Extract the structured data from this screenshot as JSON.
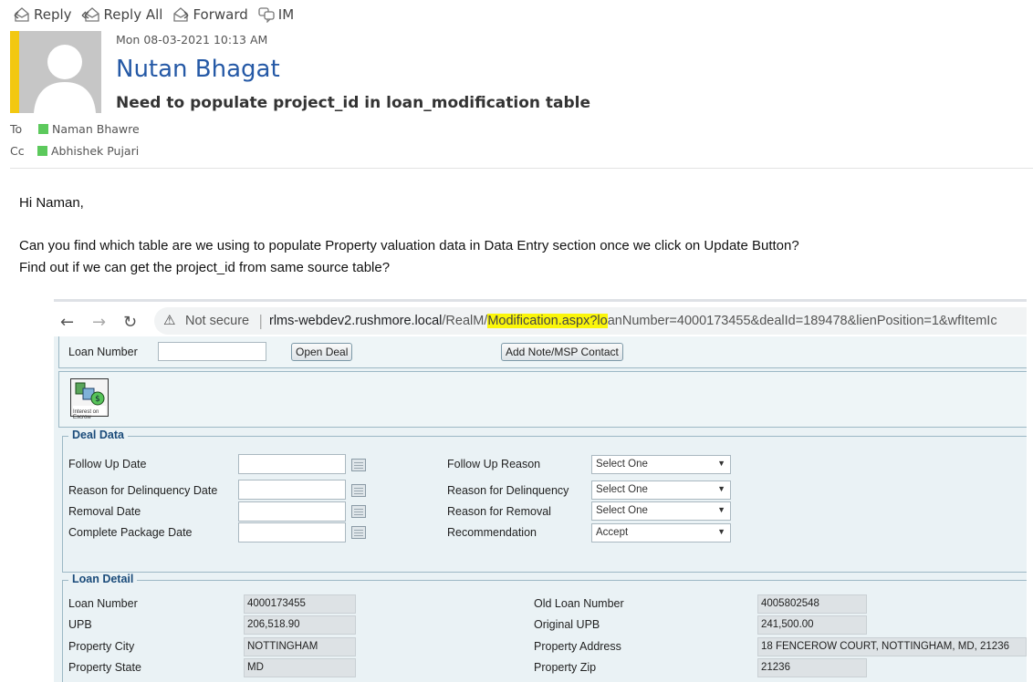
{
  "toolbar": {
    "reply": "Reply",
    "reply_all": "Reply All",
    "forward": "Forward",
    "im": "IM"
  },
  "email": {
    "date": "Mon 08-03-2021 10:13 AM",
    "sender": "Nutan Bhagat",
    "subject": "Need to populate project_id in loan_modification table",
    "to_label": "To",
    "to_name": "Naman Bhawre",
    "cc_label": "Cc",
    "cc_name": "Abhishek Pujari",
    "presence_color": "#5cc95c"
  },
  "body": {
    "greeting": "Hi Naman,",
    "line1": "Can you find which table are we using to populate Property valuation data in Data Entry section once we click on Update Button?",
    "line2": "Find out if we can get the project_id from same source table?"
  },
  "browser": {
    "security": "Not secure",
    "url_host": "rlms-webdev2.rushmore.local",
    "url_path1": "/RealM/",
    "url_highlight": "Modification.aspx?lo",
    "url_rest": "anNumber=4000173455&dealId=189478&lienPosition=1&wfItemIc",
    "highlight_color": "#fbf60a"
  },
  "app": {
    "loan_number_label": "Loan Number",
    "open_deal": "Open Deal",
    "add_note": "Add Note/MSP Contact",
    "icon_caption": "Interest on Escrow",
    "deal_data": {
      "legend": "Deal Data",
      "follow_up_date": "Follow Up Date",
      "reason_delinquency_date": "Reason for Delinquency Date",
      "removal_date": "Removal Date",
      "complete_package_date": "Complete Package Date",
      "follow_up_reason": "Follow Up Reason",
      "reason_delinquency": "Reason for Delinquency",
      "reason_removal": "Reason for Removal",
      "recommendation": "Recommendation",
      "sel_follow_up_reason": "Select One",
      "sel_reason_delinquency": "Select One",
      "sel_reason_removal": "Select One",
      "sel_recommendation": "Accept"
    },
    "loan_detail": {
      "legend": "Loan Detail",
      "loan_number_label": "Loan Number",
      "loan_number": "4000173455",
      "upb_label": "UPB",
      "upb": "206,518.90",
      "city_label": "Property City",
      "city": "NOTTINGHAM",
      "state_label": "Property State",
      "state": "MD",
      "old_loan_label": "Old Loan Number",
      "old_loan": "4005802548",
      "orig_upb_label": "Original UPB",
      "orig_upb": "241,500.00",
      "address_label": "Property Address",
      "address": "18 FENCEROW COURT, NOTTINGHAM, MD, 21236",
      "zip_label": "Property Zip",
      "zip": "21236"
    }
  }
}
